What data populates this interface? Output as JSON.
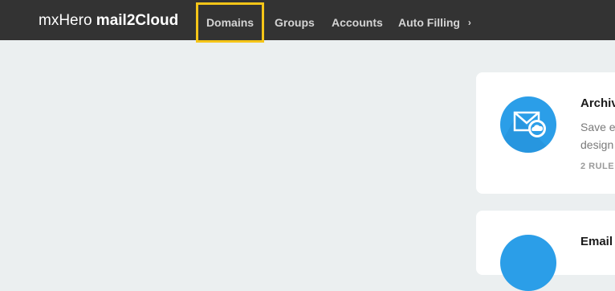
{
  "brand": {
    "prefix": "mxHero",
    "product": "mail2Cloud"
  },
  "nav": {
    "items": [
      {
        "label": "Domains"
      },
      {
        "label": "Groups"
      },
      {
        "label": "Accounts"
      },
      {
        "label": "Auto Filling"
      }
    ]
  },
  "cards": [
    {
      "title": "Archiv",
      "description_lines": [
        "Save e",
        "design"
      ],
      "meta": "2 RULE",
      "icon": "mail-cloud-icon"
    },
    {
      "title": "Email",
      "icon": "mail-cloud-icon"
    }
  ],
  "colors": {
    "topbar": "#333333",
    "background": "#ebeff0",
    "highlight": "#f5c518",
    "icon_blue": "#2b9ee8"
  }
}
